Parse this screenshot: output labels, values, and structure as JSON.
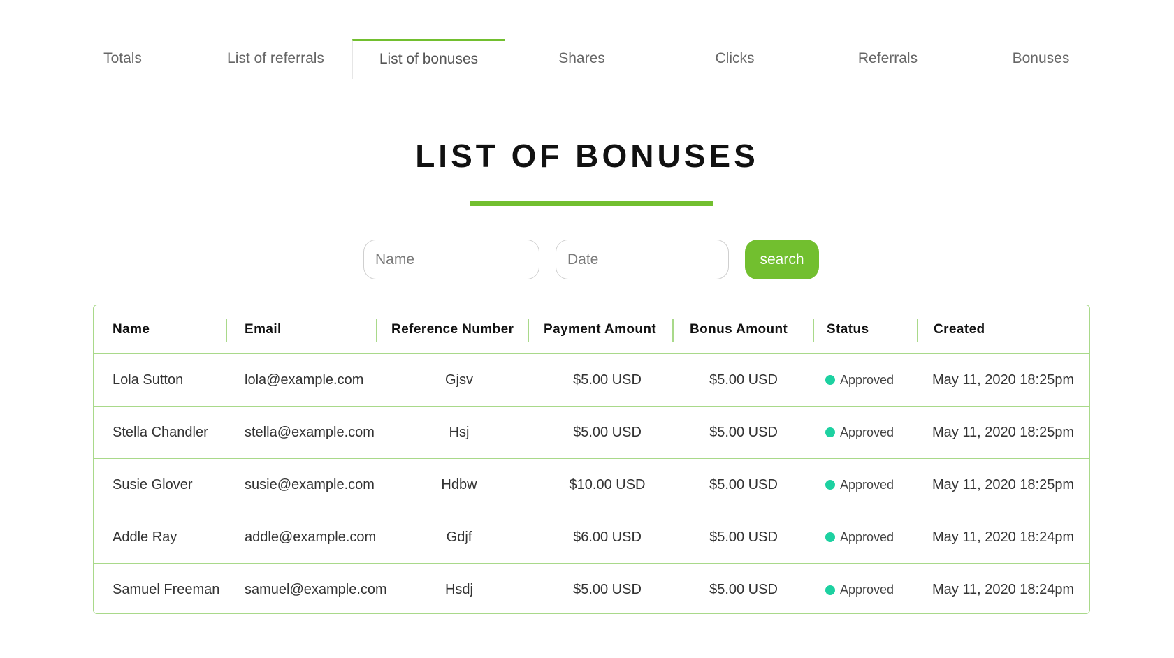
{
  "tabs": [
    {
      "label": "Totals"
    },
    {
      "label": "List of referrals"
    },
    {
      "label": "List of bonuses"
    },
    {
      "label": "Shares"
    },
    {
      "label": "Clicks"
    },
    {
      "label": "Referrals"
    },
    {
      "label": "Bonuses"
    }
  ],
  "active_tab": "List of bonuses",
  "page": {
    "title": "LIST OF BONUSES"
  },
  "search": {
    "name_placeholder": "Name",
    "date_placeholder": "Date",
    "button_label": "search"
  },
  "table": {
    "columns": [
      "Name",
      "Email",
      "Reference Number",
      "Payment Amount",
      "Bonus Amount",
      "Status",
      "Created"
    ],
    "rows": [
      {
        "name": "Lola Sutton",
        "email": "lola@example.com",
        "ref": "Gjsv",
        "payment": "$5.00 USD",
        "bonus": "$5.00 USD",
        "status": "Approved",
        "created": "May 11, 2020 18:25pm"
      },
      {
        "name": "Stella Chandler",
        "email": "stella@example.com",
        "ref": "Hsj",
        "payment": "$5.00 USD",
        "bonus": "$5.00 USD",
        "status": "Approved",
        "created": "May 11, 2020 18:25pm"
      },
      {
        "name": "Susie Glover",
        "email": "susie@example.com",
        "ref": "Hdbw",
        "payment": "$10.00 USD",
        "bonus": "$5.00 USD",
        "status": "Approved",
        "created": "May 11, 2020 18:25pm"
      },
      {
        "name": "Addle Ray",
        "email": "addle@example.com",
        "ref": "Gdjf",
        "payment": "$6.00 USD",
        "bonus": "$5.00 USD",
        "status": "Approved",
        "created": "May 11, 2020 18:24pm"
      },
      {
        "name": "Samuel Freeman",
        "email": "samuel@example.com",
        "ref": "Hsdj",
        "payment": "$5.00 USD",
        "bonus": "$5.00 USD",
        "status": "Approved",
        "created": "May 11, 2020 18:24pm"
      }
    ]
  },
  "colors": {
    "accent": "#72bf2f",
    "table_border": "#a9d98a",
    "status_approved": "#1dd1a1"
  }
}
